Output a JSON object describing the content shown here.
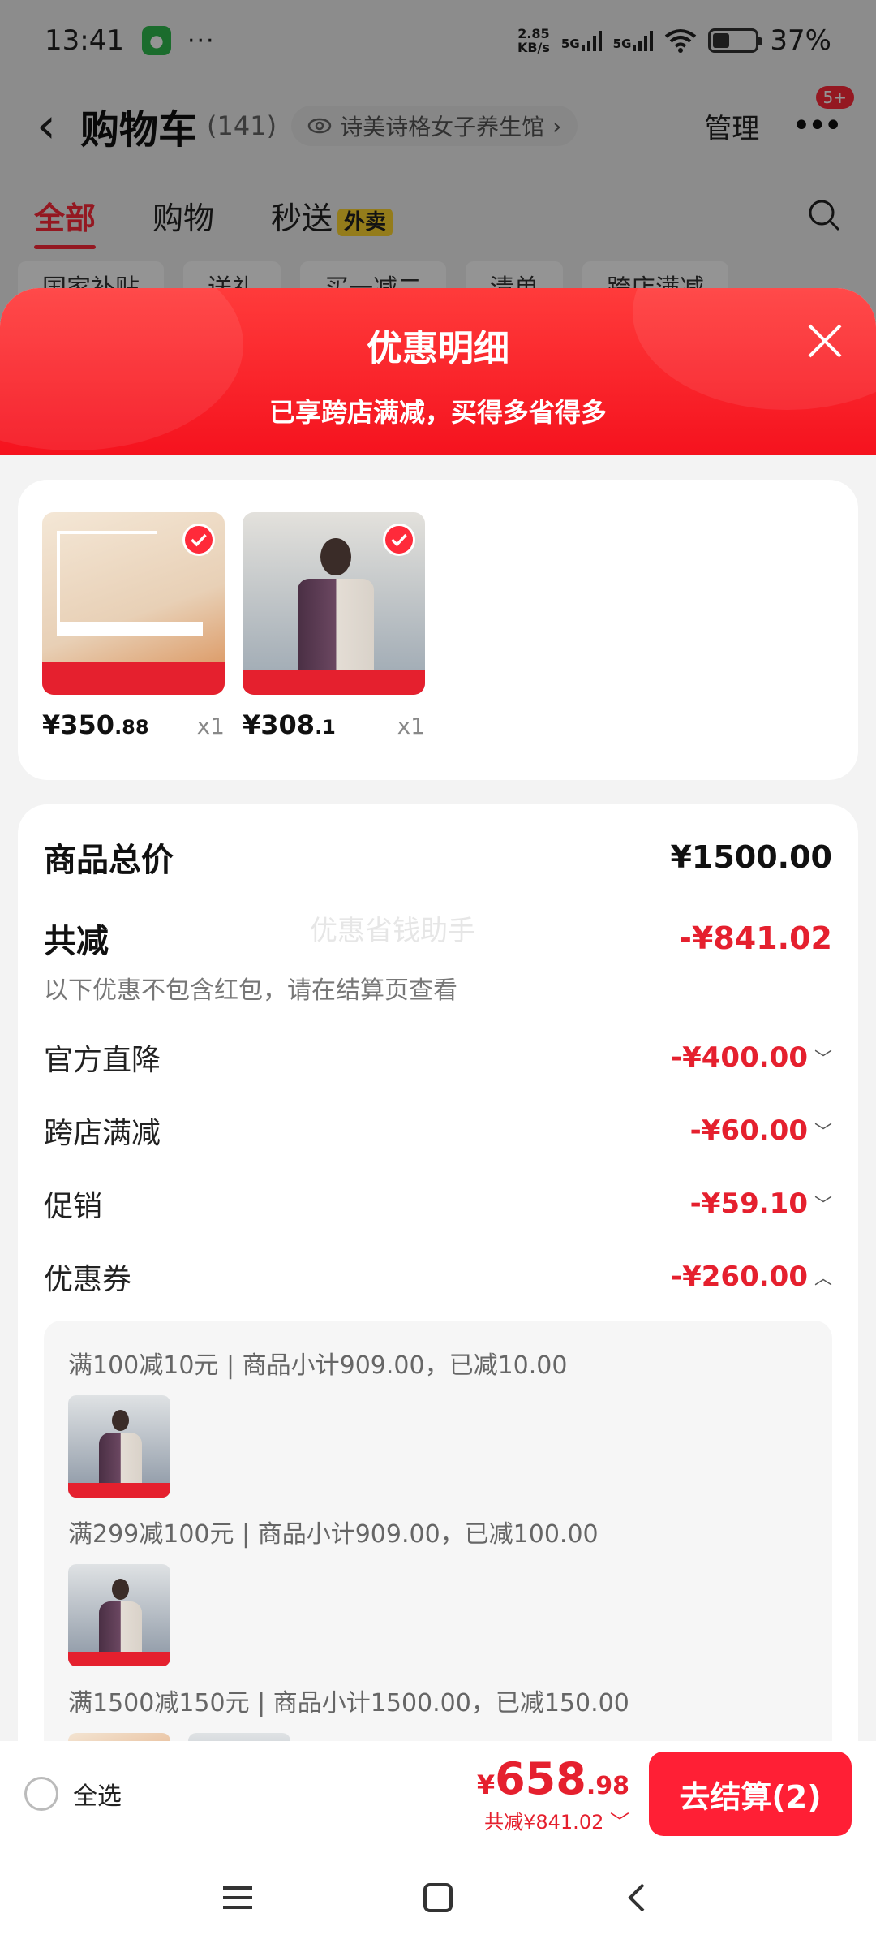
{
  "status_bar": {
    "time": "13:41",
    "dots": "···",
    "net_speed_value": "2.85",
    "net_speed_unit": "KB/s",
    "sim1": "5G",
    "sim2": "5G",
    "battery": "37%"
  },
  "header": {
    "title": "购物车",
    "count": "(141)",
    "shop_name": "诗美诗格女子养生馆",
    "manage": "管理",
    "more_badge": "5+"
  },
  "tabs": [
    {
      "label": "全部"
    },
    {
      "label": "购物"
    },
    {
      "label": "秒送",
      "badge": "外卖"
    }
  ],
  "filters": [
    "国家补贴",
    "送礼",
    "买一减二",
    "清单",
    "跨店满减"
  ],
  "sheet": {
    "title": "优惠明细",
    "subtitle": "已享跨店满减，买得多省得多",
    "products": [
      {
        "price_main": "¥350",
        "price_decimal": ".88",
        "qty": "x1"
      },
      {
        "price_main": "¥308",
        "price_decimal": ".1",
        "qty": "x1"
      }
    ],
    "total_label": "商品总价",
    "total_value": "¥1500.00",
    "reduce_label": "共减",
    "reduce_value": "-¥841.02",
    "watermark": "优惠省钱助手",
    "note": "以下优惠不包含红包，请在结算页查看",
    "items": [
      {
        "label": "官方直降",
        "value": "-¥400.00"
      },
      {
        "label": "跨店满减",
        "value": "-¥60.00"
      },
      {
        "label": "促销",
        "value": "-¥59.10"
      },
      {
        "label": "优惠券",
        "value": "-¥260.00"
      }
    ],
    "coupons": [
      "满100减10元 | 商品小计909.00，已减10.00",
      "满299减100元 | 商品小计909.00，已减100.00",
      "满1500减150元 | 商品小计1500.00，已减150.00"
    ]
  },
  "bottom_bar": {
    "select_all": "全选",
    "price_symbol": "¥",
    "price_int": "658",
    "price_dec": ".98",
    "reduce_text": "共减¥841.02",
    "checkout": "去结算(2)"
  },
  "colors": {
    "accent": "#ff2a3a",
    "discount": "#e5202e"
  }
}
